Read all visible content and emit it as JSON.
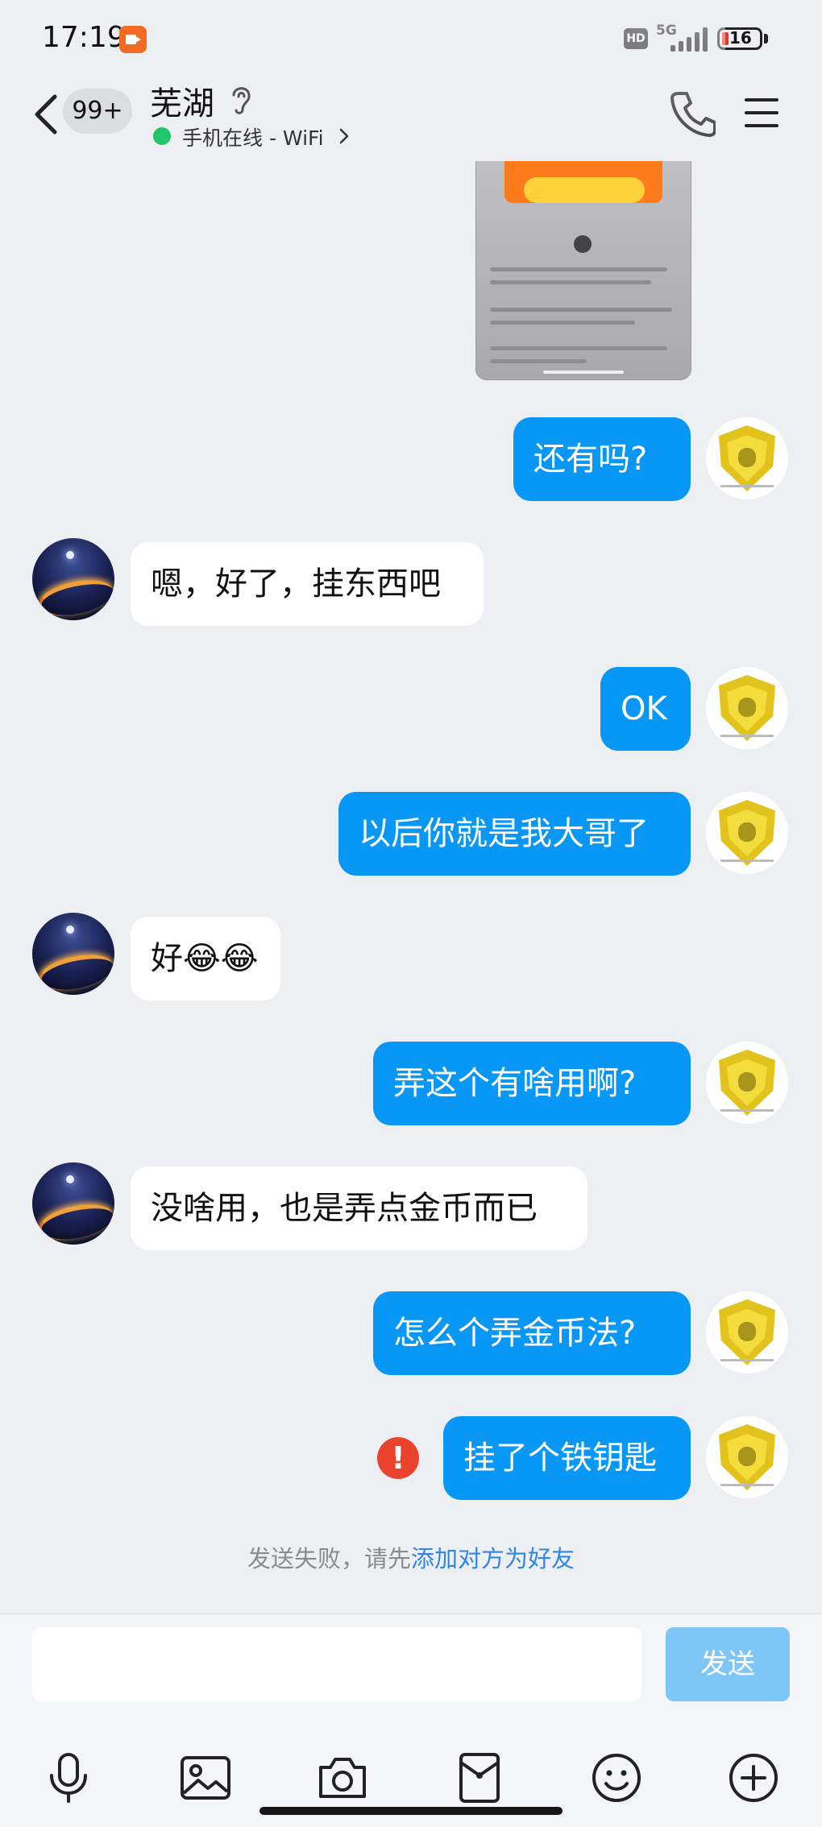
{
  "status_bar": {
    "time": "17:19",
    "network": "5G",
    "hd": "HD",
    "battery": "16"
  },
  "header": {
    "back_badge": "99+",
    "contact_name": "芜湖",
    "online_status": "手机在线 - WiFi"
  },
  "messages": [
    {
      "side": "self",
      "text": "还有吗?"
    },
    {
      "side": "friend",
      "text": "嗯，好了，挂东西吧"
    },
    {
      "side": "self",
      "text": "OK"
    },
    {
      "side": "self",
      "text": "以后你就是我大哥了"
    },
    {
      "side": "friend",
      "text": "好😂😂"
    },
    {
      "side": "self",
      "text": "弄这个有啥用啊?"
    },
    {
      "side": "friend",
      "text": "没啥用，也是弄点金币而已"
    },
    {
      "side": "self",
      "text": "怎么个弄金币法?"
    },
    {
      "side": "self",
      "text": "挂了个铁钥匙",
      "failed": true,
      "fail_mark": "!"
    }
  ],
  "notice": {
    "prefix": "发送失败，请先",
    "link": "添加对方为好友"
  },
  "input": {
    "placeholder": "",
    "send_label": "发送"
  },
  "toolbar": [
    "microphone-icon",
    "image-icon",
    "camera-icon",
    "red-packet-icon",
    "emoji-icon",
    "plus-icon"
  ],
  "colors": {
    "self_bubble": "#0997f5",
    "friend_bubble": "#ffffff",
    "background": "#eeeff3",
    "link": "#2f86e6",
    "online": "#21c66a",
    "error": "#e9432d"
  }
}
